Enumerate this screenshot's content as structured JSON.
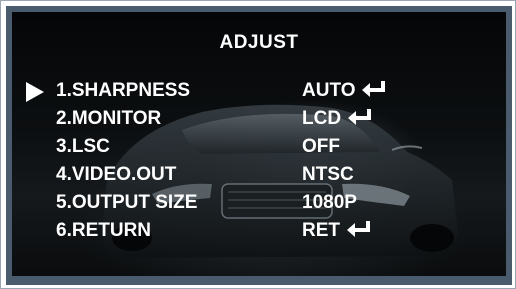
{
  "menu": {
    "title": "ADJUST",
    "items": [
      {
        "label": "1.SHARPNESS",
        "value": "AUTO",
        "has_enter": true,
        "selected": true
      },
      {
        "label": "2.MONITOR",
        "value": "LCD",
        "has_enter": true,
        "selected": false
      },
      {
        "label": "3.LSC",
        "value": "OFF",
        "has_enter": false,
        "selected": false
      },
      {
        "label": "4.VIDEO.OUT",
        "value": "NTSC",
        "has_enter": false,
        "selected": false
      },
      {
        "label": "5.OUTPUT SIZE",
        "value": "1080P",
        "has_enter": false,
        "selected": false
      },
      {
        "label": "6.RETURN",
        "value": "RET",
        "has_enter": true,
        "selected": false
      }
    ]
  },
  "icons": {
    "cursor": "triangle-right-icon",
    "enter": "enter-return-icon"
  },
  "colors": {
    "text": "#ffffff",
    "bezel": "#4a5b6e",
    "background": "#0a0c0d"
  }
}
